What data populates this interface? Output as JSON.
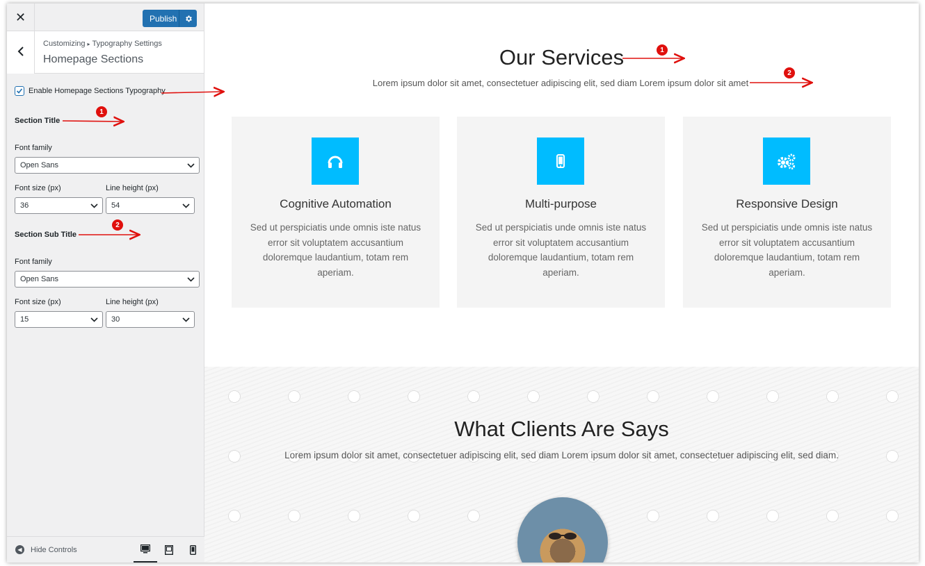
{
  "sidebar": {
    "close_label": "✕",
    "publish_label": "Publish",
    "breadcrumb_root": "Customizing",
    "breadcrumb_child": "Typography Settings",
    "section_title": "Homepage Sections",
    "enable_label": "Enable Homepage Sections Typography",
    "enable_checked": true,
    "section_title_group": {
      "heading": "Section Title",
      "font_family_label": "Font family",
      "font_family_value": "Open Sans",
      "font_size_label": "Font size (px)",
      "font_size_value": "36",
      "line_height_label": "Line height (px)",
      "line_height_value": "54"
    },
    "section_subtitle_group": {
      "heading": "Section Sub Title",
      "font_family_label": "Font family",
      "font_family_value": "Open Sans",
      "font_size_label": "Font size (px)",
      "font_size_value": "15",
      "line_height_label": "Line height (px)",
      "line_height_value": "30"
    },
    "hide_controls_label": "Hide Controls",
    "devices": [
      "desktop-icon",
      "tablet-icon",
      "mobile-icon"
    ]
  },
  "annotations": {
    "badge_1": "1",
    "badge_2": "2",
    "arrow_color": "#e0100d"
  },
  "preview": {
    "services_title": "Our Services",
    "services_subtitle": "Lorem ipsum dolor sit amet, consectetuer adipiscing elit, sed diam Lorem ipsum dolor sit amet",
    "cards": [
      {
        "icon": "headphones-icon",
        "title": "Cognitive Automation",
        "desc": "Sed ut perspiciatis unde omnis iste natus error sit voluptatem accusantium doloremque laudantium, totam rem aperiam."
      },
      {
        "icon": "mobile-phone-icon",
        "title": "Multi-purpose",
        "desc": "Sed ut perspiciatis unde omnis iste natus error sit voluptatem accusantium doloremque laudantium, totam rem aperiam."
      },
      {
        "icon": "gears-icon",
        "title": "Responsive Design",
        "desc": "Sed ut perspiciatis unde omnis iste natus error sit voluptatem accusantium doloremque laudantium, totam rem aperiam."
      }
    ],
    "clients_title": "What Clients Are Says",
    "clients_subtitle": "Lorem ipsum dolor sit amet, consectetuer adipiscing elit, sed diam Lorem ipsum dolor sit amet, consectetuer adipiscing elit, sed diam.",
    "accent_color": "#00bcff"
  }
}
